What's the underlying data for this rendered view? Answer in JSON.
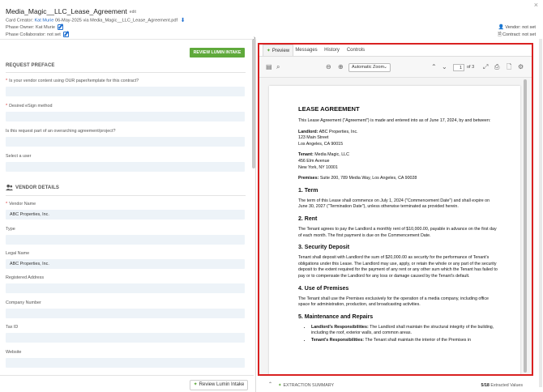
{
  "header": {
    "title": "Media_Magic__LLC_Lease_Agreement",
    "edit_tag": "edit",
    "card_creator_label": "Card Creator:",
    "card_creator_name": "Kat Murie",
    "card_creator_rest": "06-May-2025 via Media_Magic__LLC_Lease_Agreement.pdf",
    "phase_owner": "Phase Owner: Kat Murie",
    "phase_collaborator": "Phase Collaborator: not set",
    "vendor": "Vendor: not set",
    "contract": "Contract: not set",
    "close": "×"
  },
  "left": {
    "review_button": "REVIEW LUMIN INTAKE",
    "request_preface_title": "REQUEST PREFACE",
    "q1": "Is your vendor content using OUR paper/template for this contract?",
    "q2": "Desired eSign method",
    "q3": "Is this request part of an overarching agreement/project?",
    "q4": "Select a user",
    "vendor_details_title": "VENDOR DETAILS",
    "vendor_name_label": "Vendor Name",
    "vendor_name_value": "ABC Properties, Inc.",
    "type_label": "Type",
    "legal_name_label": "Legal Name",
    "legal_name_value": "ABC Properties, Inc.",
    "registered_address_label": "Registered Address",
    "company_number_label": "Company Number",
    "tax_id_label": "Tax ID",
    "website_label": "Website",
    "bottom_button": "Review Lumin Intake"
  },
  "tabs": [
    {
      "label": "Preview"
    },
    {
      "label": "Messages"
    },
    {
      "label": "History"
    },
    {
      "label": "Controls"
    }
  ],
  "viewer": {
    "zoom": "Automatic Zoom",
    "page_current": "1",
    "page_total": "of 3"
  },
  "document": {
    "title": "LEASE AGREEMENT",
    "intro": "This Lease Agreement (\"Agreement\") is made and entered into as of June 17, 2024, by and between:",
    "landlord_label": "Landlord:",
    "landlord_name": "ABC Properties, Inc.",
    "landlord_addr1": "123 Main Street",
    "landlord_addr2": "Los Angeles, CA 90015",
    "tenant_label": "Tenant:",
    "tenant_name": "Media Magic, LLC",
    "tenant_addr1": "456 Elm Avenue",
    "tenant_addr2": "New York, NY 10001",
    "premises_label": "Premises:",
    "premises_value": "Suite 200, 789 Media Way, Los Angeles, CA 90028",
    "s1_title": "1. Term",
    "s1_body": "The term of this Lease shall commence on July 1, 2024 (\"Commencement Date\") and shall expire on June 30, 2027 (\"Termination Date\"), unless otherwise terminated as provided herein.",
    "s2_title": "2. Rent",
    "s2_body": "The Tenant agrees to pay the Landlord a monthly rent of $10,000.00, payable in advance on the first day of each month. The first payment is due on the Commencement Date.",
    "s3_title": "3. Security Deposit",
    "s3_body": "Tenant shall deposit with Landlord the sum of $20,000.00 as security for the performance of Tenant's obligations under this Lease. The Landlord may use, apply, or retain the whole or any part of the security deposit to the extent required for the payment of any rent or any other sum which the Tenant has failed to pay or to compensate the Landlord for any loss or damage caused by the Tenant's default.",
    "s4_title": "4. Use of Premises",
    "s4_body": "The Tenant shall use the Premises exclusively for the operation of a media company, including office space for administration, production, and broadcasting activities.",
    "s5_title": "5. Maintenance and Repairs",
    "s5_b1_label": "Landlord's Responsibilities:",
    "s5_b1_body": "The Landlord shall maintain the structural integrity of the building, including the roof, exterior walls, and common areas.",
    "s5_b2_label": "Tenant's Responsibilities:",
    "s5_b2_body": "The Tenant shall maintain the interior of the Premises in"
  },
  "footer": {
    "extraction_summary": "EXTRACTION SUMMARY",
    "extracted_count": "5/18",
    "extracted_label": "Extracted Values"
  },
  "colors": {
    "accent_green": "#5fa93b",
    "link_blue": "#2a6fc9",
    "highlight_red": "#d92121",
    "field_bg": "#edf3f8"
  }
}
